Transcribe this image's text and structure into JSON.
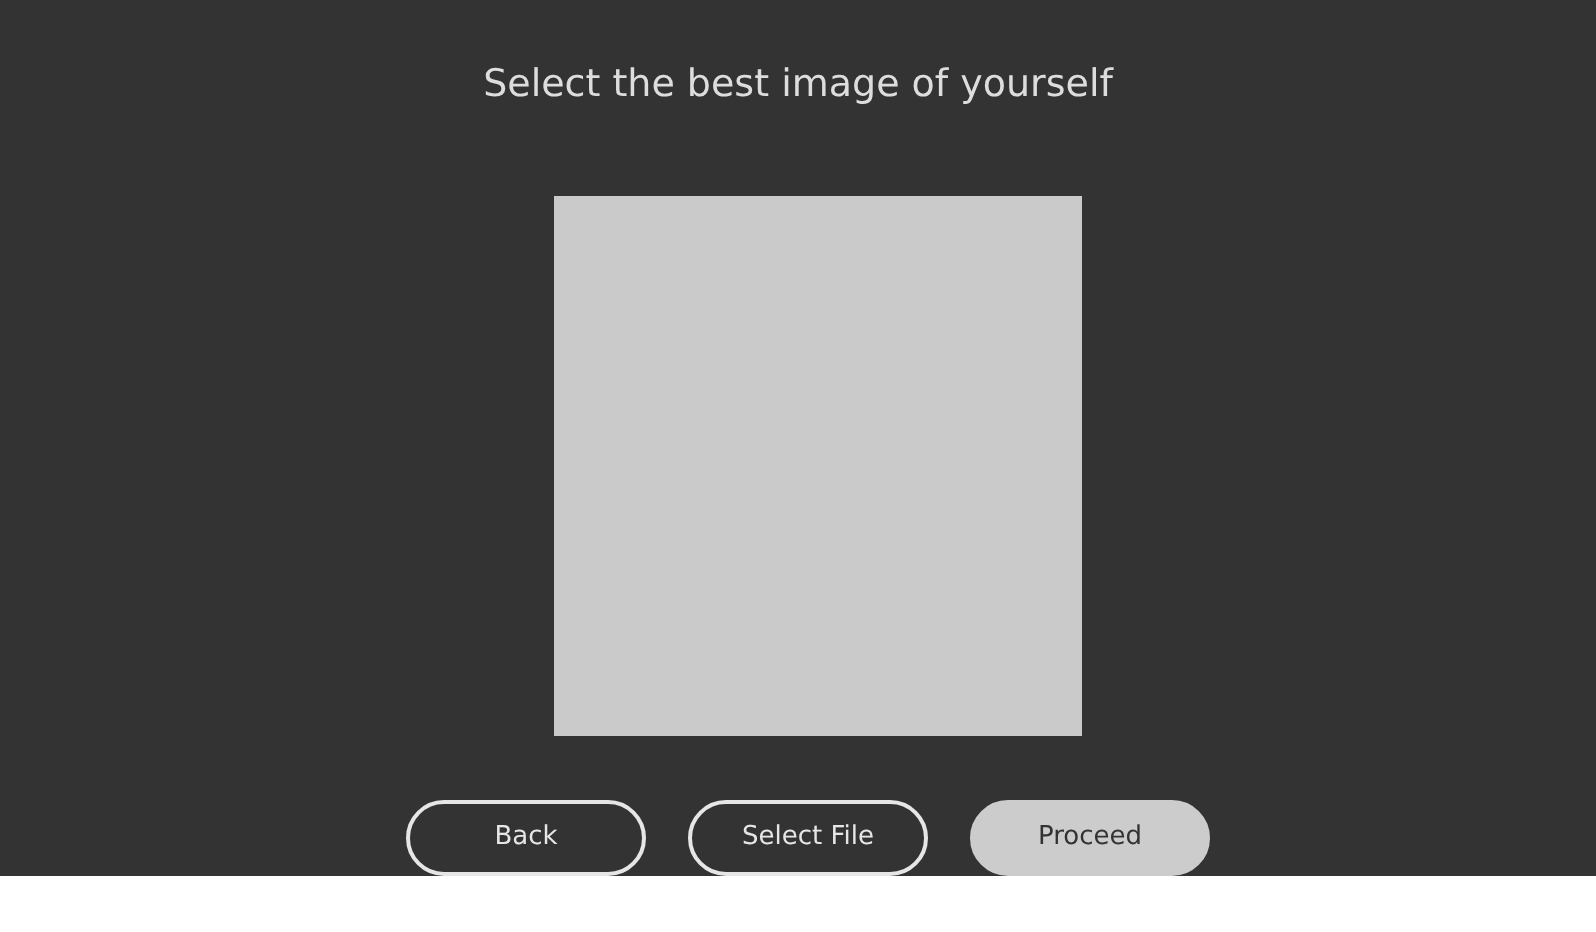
{
  "title": "Select the best image of yourself",
  "buttons": [
    {
      "label": "Back",
      "kind": "outline"
    },
    {
      "label": "Select File",
      "kind": "outline"
    },
    {
      "label": "Proceed",
      "kind": "filled"
    }
  ]
}
